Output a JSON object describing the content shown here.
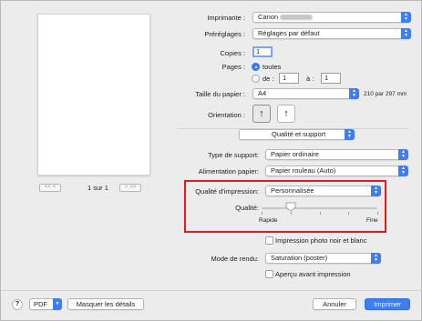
{
  "printer": {
    "label": "Imprimante :",
    "value": "Canon"
  },
  "presets": {
    "label": "Préréglages :",
    "value": "Réglages par défaut"
  },
  "copies": {
    "label": "Copies :",
    "value": "1"
  },
  "pages": {
    "label": "Pages :",
    "all_label": "toutes",
    "from_label": "de :",
    "from_value": "1",
    "to_label": "à :",
    "to_value": "1",
    "selected": "all"
  },
  "paper_size": {
    "label": "Taille du papier :",
    "value": "A4",
    "dimensions": "210 par 297 mm"
  },
  "orientation": {
    "label": "Orientation :",
    "selected": "portrait"
  },
  "section": {
    "value": "Qualité et support"
  },
  "media_type": {
    "label": "Type de support:",
    "value": "Papier ordinaire"
  },
  "paper_source": {
    "label": "Alimentation papier:",
    "value": "Papier rouleau (Auto)"
  },
  "print_quality": {
    "label": "Qualité d'impression:",
    "value": "Personnalisée"
  },
  "quality_slider": {
    "label": "Qualité:",
    "min_label": "Rapide",
    "max_label": "Fine",
    "ticks": 5,
    "level": 0.25
  },
  "grayscale": {
    "label": "Impression photo noir et blanc",
    "checked": false
  },
  "render_mode": {
    "label": "Mode de rendu:",
    "value": "Saturation (poster)"
  },
  "preview_option": {
    "label": "Aperçu avant impression",
    "checked": false
  },
  "page_nav": {
    "text": "1 sur 1",
    "first": "<<",
    "prev": "<",
    "next": ">",
    "last": ">>"
  },
  "footer": {
    "help": "?",
    "pdf": "PDF",
    "hide_details": "Masquer les détails",
    "cancel": "Annuler",
    "print": "Imprimer"
  },
  "colors": {
    "accent": "#3d7ff0",
    "highlight": "#e21c1c"
  }
}
